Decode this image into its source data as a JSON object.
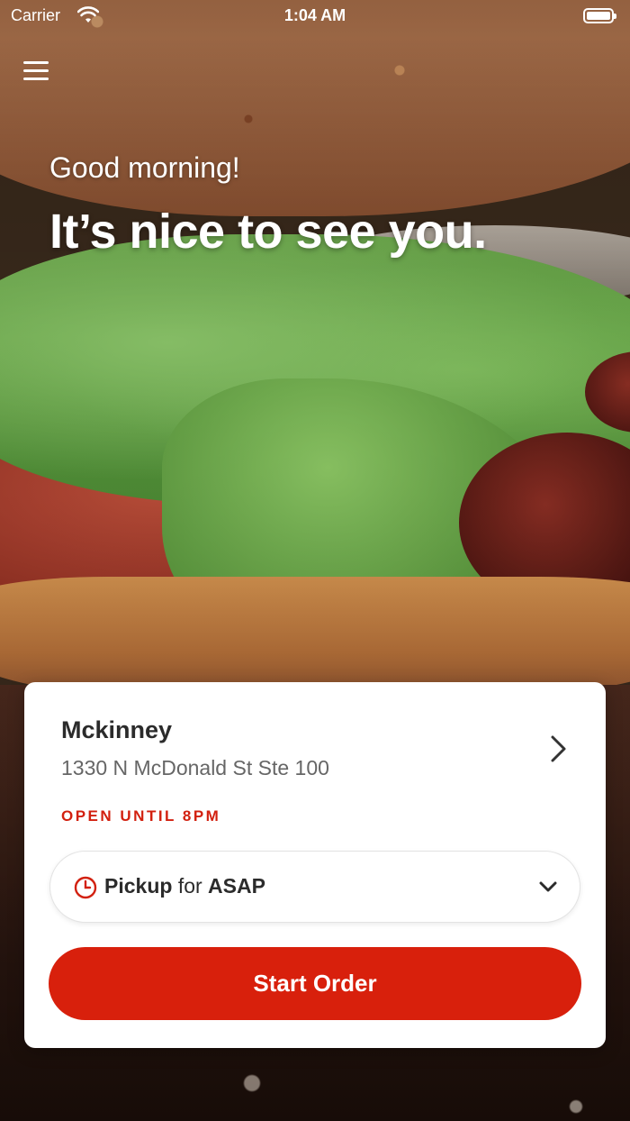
{
  "status_bar": {
    "carrier": "Carrier",
    "time": "1:04 AM",
    "wifi_icon": "wifi-icon",
    "battery_icon": "battery-icon"
  },
  "header": {
    "menu_icon": "hamburger-menu-icon",
    "greeting": "Good morning!",
    "headline": "It’s nice to see you."
  },
  "location": {
    "name": "Mckinney",
    "address": "1330 N McDonald St Ste 100",
    "hours": "OPEN UNTIL 8PM",
    "chevron_icon": "chevron-right-icon"
  },
  "order_mode": {
    "icon": "clock-icon",
    "mode": "Pickup",
    "connector": "for",
    "time": "ASAP",
    "caret_icon": "chevron-down-icon"
  },
  "actions": {
    "start_order_label": "Start Order"
  },
  "colors": {
    "brand_red": "#d8200c",
    "hours_red": "#d2200f",
    "card_bg": "#ffffff",
    "text_dark": "#2b2b2b",
    "text_muted": "#666666"
  }
}
